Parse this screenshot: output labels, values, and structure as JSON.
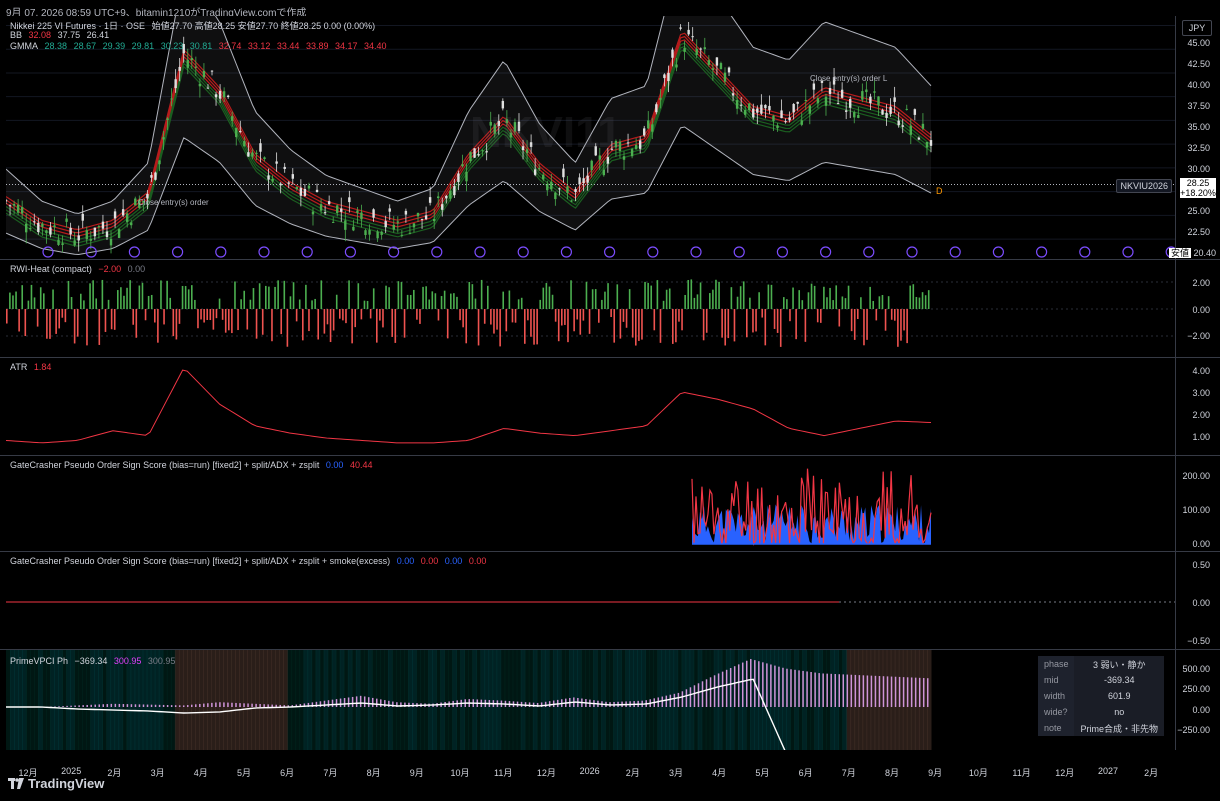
{
  "header": {
    "text": "9月 07, 2026 08:59 UTC+9、bitamin1210がTradingView.comで作成"
  },
  "currency": "JPY",
  "watermark": "NKVI11",
  "main": {
    "title": "Nikkei 225 VI Futures · 1日 · OSE",
    "ohlc": "始値27.70  高値28.25  安値27.70  終値28.25  0.00 (0.00%)",
    "bb_label": "BB",
    "bb_values": [
      "32.08",
      "37.75",
      "26.41"
    ],
    "gmma_label": "GMMA",
    "gmma_green": [
      "28.38",
      "28.67",
      "29.39",
      "29.81",
      "30.23",
      "30.81"
    ],
    "gmma_red": [
      "32.74",
      "33.12",
      "33.44",
      "33.89",
      "34.17",
      "34.40"
    ],
    "yticks": [
      "45.00",
      "42.50",
      "40.00",
      "37.50",
      "35.00",
      "32.50",
      "30.00",
      "27.50",
      "25.00",
      "22.50"
    ],
    "price_symbol": "NKVIU2026",
    "price": "28.25",
    "price_change": "+18.20%",
    "low_tag": "安値",
    "low_value": "20.40",
    "annot_left": "Close entry(s) order",
    "annot_right": "Close entry(s) order L",
    "d_marker": "D"
  },
  "rwi": {
    "label": "RWI-Heat (compact)",
    "value": "−2.00",
    "value2": "0.00",
    "yticks": [
      "2.00",
      "0.00",
      "−2.00"
    ]
  },
  "atr": {
    "label": "ATR",
    "value": "1.84",
    "yticks": [
      "4.00",
      "3.00",
      "2.00",
      "1.00"
    ]
  },
  "gc1": {
    "label": "GateCrasher Pseudo Order Sign Score (bias=run) [fixed2] + split/ADX + zsplit",
    "values": [
      "0.00",
      "40.44"
    ],
    "yticks": [
      "200.00",
      "100.00",
      "0.00"
    ]
  },
  "gc2": {
    "label": "GateCrasher Pseudo Order Sign Score (bias=run) [fixed2] + split/ADX + zsplit + smoke(excess)",
    "values": [
      "0.00",
      "0.00",
      "0.00",
      "0.00"
    ],
    "yticks": [
      "0.50",
      "0.00",
      "−0.50"
    ]
  },
  "prime": {
    "label": "PrimeVPCI Ph",
    "values": [
      "−369.34",
      "300.95",
      "300.95"
    ],
    "yticks": [
      "500.00",
      "250.00",
      "0.00",
      "−250.00"
    ],
    "table": [
      {
        "k": "phase",
        "v": "3 弱い・静か"
      },
      {
        "k": "mid",
        "v": "-369.34"
      },
      {
        "k": "width",
        "v": "601.9"
      },
      {
        "k": "wide?",
        "v": "no"
      },
      {
        "k": "note",
        "v": "Prime合成・非先物"
      }
    ]
  },
  "xaxis": [
    "12月",
    "2025",
    "2月",
    "3月",
    "4月",
    "5月",
    "6月",
    "7月",
    "8月",
    "9月",
    "10月",
    "11月",
    "12月",
    "2026",
    "2月",
    "3月",
    "4月",
    "5月",
    "6月",
    "7月",
    "8月",
    "9月",
    "10月",
    "11月",
    "12月",
    "2027",
    "2月"
  ],
  "footer": "TradingView",
  "colors": {
    "up": "#22ab94",
    "down": "#f23645",
    "blue": "#2962ff",
    "purple": "#e040fb",
    "bg": "#000000"
  },
  "chart_data": [
    {
      "type": "line",
      "title": "Nikkei 225 VI Futures · 1日 · OSE",
      "ylim": [
        20.4,
        46
      ],
      "series": [
        {
          "name": "BB",
          "values": [
            26.5,
            24,
            23,
            24,
            27,
            42,
            38,
            31,
            28,
            26,
            25,
            24,
            25,
            31,
            35,
            30,
            27,
            32,
            33,
            44,
            40,
            36,
            35,
            38,
            37,
            36,
            33
          ]
        }
      ]
    },
    {
      "type": "line",
      "title": "ATR",
      "ylim": [
        0.5,
        4.5
      ],
      "series": [
        {
          "name": "ATR",
          "values": [
            1.1,
            1.0,
            1.1,
            1.5,
            1.3,
            4.1,
            2.6,
            1.7,
            1.4,
            1.2,
            1.1,
            1.0,
            1.0,
            1.1,
            1.6,
            1.4,
            1.3,
            1.5,
            1.7,
            3.1,
            2.8,
            2.4,
            1.6,
            1.3,
            1.6,
            1.9,
            1.84
          ]
        }
      ]
    }
  ]
}
